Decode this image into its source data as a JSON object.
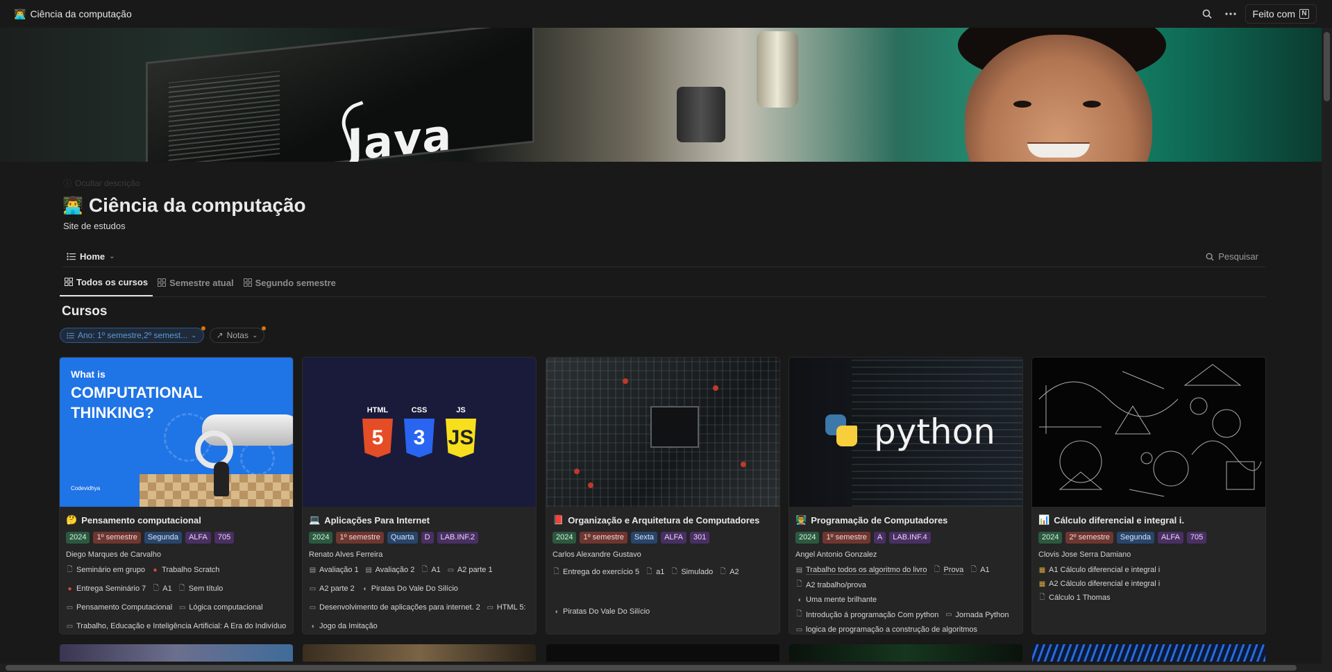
{
  "topbar": {
    "emoji": "👨‍💻",
    "title": "Ciência da computação",
    "made_with": "Feito com",
    "made_with_logo": "N"
  },
  "page": {
    "hide_description": "Ocultar descrição",
    "emoji": "👨‍💻",
    "title": "Ciência da computação",
    "subtitle": "Site de estudos"
  },
  "viewbar": {
    "home_label": "Home",
    "search_label": "Pesquisar"
  },
  "tabs": [
    {
      "label": "Todos os cursos",
      "active": true
    },
    {
      "label": "Semestre atual",
      "active": false
    },
    {
      "label": "Segundo semestre",
      "active": false
    }
  ],
  "section_title": "Cursos",
  "filters": {
    "ano_label": "Ano: 1º semestre,2º semest...",
    "notas_label": "Notas"
  },
  "cover_text": "Java",
  "card_images": {
    "ct_line1": "What is",
    "ct_line2": "COMPUTATIONAL",
    "ct_line3": "THINKING?",
    "ct_brand": "Codevidhya",
    "html": "HTML",
    "css": "CSS",
    "js": "JS",
    "python": "python"
  },
  "cards": [
    {
      "emoji": "🤔",
      "title": "Pensamento computacional",
      "tags": [
        "2024",
        "1º semestre",
        "Segunda",
        "ALFA",
        "705"
      ],
      "professor": "Diego Marques de Carvalho",
      "links": [
        "Seminário em grupo",
        "Trabalho Scratch",
        "Entrega Seminário 7",
        "A1",
        "Sem título",
        "Pensamento Computacional",
        "Lógica computacional",
        "Trabalho, Educação e Inteligência Artificial: A Era do Indivíduo Versátil"
      ]
    },
    {
      "emoji": "💻",
      "title": "Aplicações Para Internet",
      "tags": [
        "2024",
        "1º semestre",
        "Quarta",
        "D",
        "LAB.INF.2"
      ],
      "professor": "Renato Alves Ferreira",
      "links": [
        "Avaliação 1",
        "Avaliação 2",
        "A1",
        "A2 parte 1",
        "A2 parte 2",
        "Piratas Do Vale Do Silício",
        "Desenvolvimento de aplicações para internet. 2",
        "HTML 5:",
        "Jogo da Imitação"
      ]
    },
    {
      "emoji": "📕",
      "title": "Organização e Arquitetura de Computadores",
      "tags": [
        "2024",
        "1º semestre",
        "Sexta",
        "ALFA",
        "301"
      ],
      "professor": "Carlos Alexandre Gustavo",
      "links": [
        "Entrega do exercício 5",
        "a1",
        "Simulado",
        "A2",
        "Piratas Do Vale Do Silício"
      ]
    },
    {
      "emoji": "👨‍🏫",
      "title": "Programação de Computadores",
      "tags": [
        "2024",
        "1º semestre",
        "A",
        "LAB.INF.4"
      ],
      "professor": "Angel Antonio Gonzalez",
      "links": [
        "Trabalho todos os algoritmo do livro",
        "Prova",
        "A1",
        "A2 trabalho/prova",
        "Uma mente brilhante",
        "Introdução á programação Com python",
        "Jornada Python",
        "logica de programação a construção de algoritmos"
      ]
    },
    {
      "emoji": "📊",
      "title": "Cálculo diferencial e integral i.",
      "tags": [
        "2024",
        "2º semestre",
        "Segunda",
        "ALFA",
        "705"
      ],
      "professor": "Clovis Jose Serra Damiano",
      "links": [
        "A1 Cálculo diferencial e integral i",
        "A2 Cálculo diferencial e integral i",
        "Cálculo 1 Thomas"
      ]
    }
  ],
  "colors": {
    "background": "#191919",
    "card": "#252525",
    "tag_green": "#2b593f",
    "tag_red": "#6e3630",
    "tag_blue": "#28456c",
    "tag_purple": "#492f64",
    "filter_blue": "#5a9bdb",
    "filter_dot": "#d9730d"
  }
}
